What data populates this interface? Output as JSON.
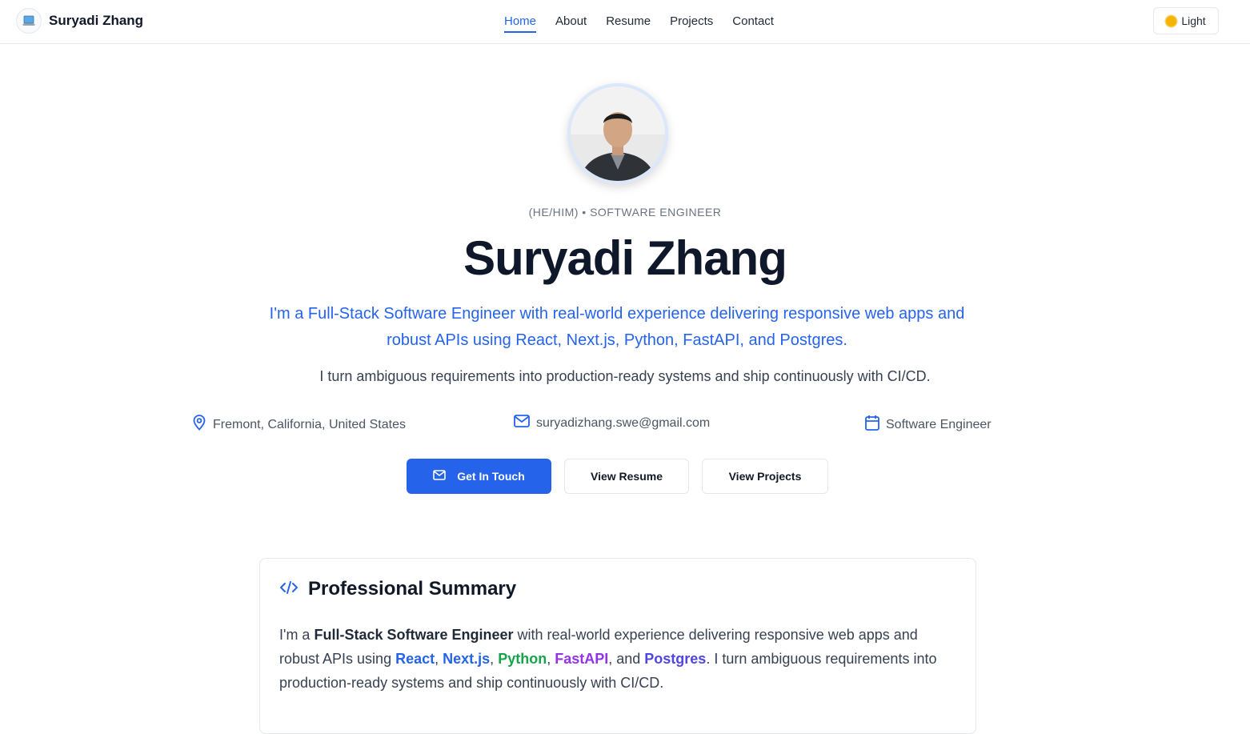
{
  "header": {
    "brand_name": "Suryadi Zhang",
    "nav": [
      {
        "label": "Home",
        "active": true
      },
      {
        "label": "About",
        "active": false
      },
      {
        "label": "Resume",
        "active": false
      },
      {
        "label": "Projects",
        "active": false
      },
      {
        "label": "Contact",
        "active": false
      }
    ],
    "theme_label": "Light",
    "theme_icon": "sun-icon"
  },
  "hero": {
    "eyebrow": "(HE/HIM) • SOFTWARE ENGINEER",
    "name": "Suryadi Zhang",
    "lead": "I'm a Full-Stack Software Engineer with real-world experience delivering responsive web apps and robust APIs using React, Next.js, Python, FastAPI, and Postgres.",
    "sub": "I turn ambiguous requirements into production-ready systems and ship continuously with CI/CD.",
    "meta": {
      "location": "Fremont, California, United States",
      "email": "suryadizhang.swe@gmail.com",
      "role": "Software Engineer"
    },
    "buttons": {
      "contact": "Get In Touch",
      "resume": "View Resume",
      "projects": "View Projects"
    }
  },
  "summary": {
    "title": "Professional Summary",
    "p1": "I'm a ",
    "role": "Full-Stack Software Engineer",
    "p2": " with real-world experience delivering responsive web apps and robust APIs using ",
    "tech": {
      "react": "React",
      "next": "Next.js",
      "python": "Python",
      "fastapi": "FastAPI",
      "postgres": "Postgres"
    },
    "sep1": ", ",
    "sep2": ", ",
    "sep3": ", ",
    "sep4": ", and ",
    "p3": ". I turn ambiguous requirements into production-ready systems and ship continuously with CI/CD."
  },
  "colors": {
    "accent": "#2563eb",
    "python": "#16a34a",
    "fastapi": "#9333ea",
    "postgres": "#4f46e5"
  }
}
